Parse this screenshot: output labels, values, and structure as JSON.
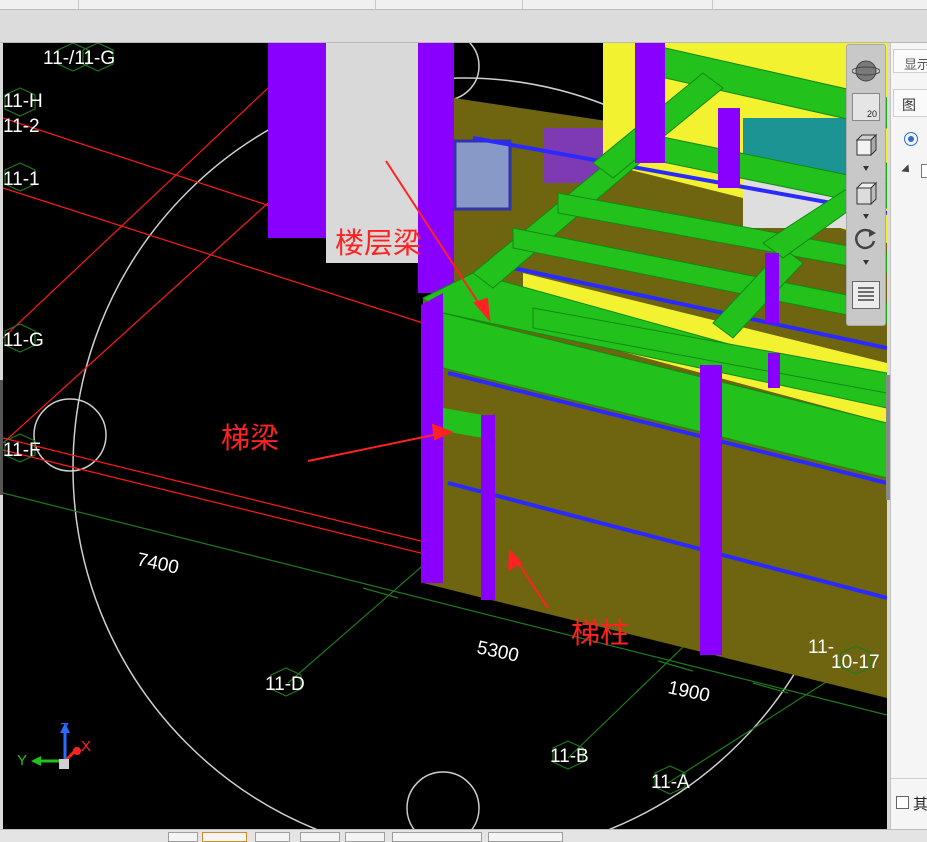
{
  "grid_labels": {
    "top_combined": "11-/11-G",
    "h": "11-H",
    "r2": "11-2",
    "r1": "11-1",
    "g": "11-G",
    "f": "11-F",
    "d": "11-D",
    "b": "11-B",
    "a": "11-A",
    "right_11": "11-",
    "right_10_17": "10-17"
  },
  "dimensions": {
    "d1": "7400",
    "d2": "5300",
    "d3": "1900"
  },
  "annotations": {
    "floor_beam": "楼层梁",
    "stair_beam": "梯梁",
    "stair_column": "梯柱"
  },
  "axes": {
    "x": "X",
    "y": "Y",
    "z": "Z"
  },
  "navbar": {
    "zoom_value": "20"
  },
  "right_panel": {
    "tab_label": "显示",
    "tab2_label": "图",
    "checkbox_label": "其"
  },
  "colors": {
    "grid_red": "#ff1a1a",
    "grid_green": "#1f7a1f",
    "column_purple": "#8a00ff",
    "beam_green": "#22c11c",
    "wall_olive": "#6f6410",
    "slab_yellow": "#f2f230",
    "annotation_red": "#ff2222"
  }
}
